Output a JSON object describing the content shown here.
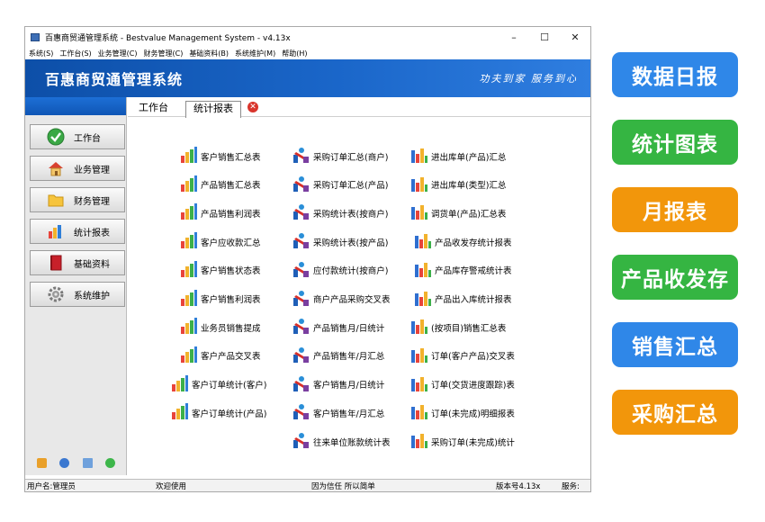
{
  "window": {
    "title": "百惠商贸通管理系统 - Bestvalue Management System - v4.13x",
    "controls": [
      "–",
      "☐",
      "✕"
    ]
  },
  "menu": [
    "系统(S)",
    "工作台(S)",
    "业务管理(C)",
    "财务管理(C)",
    "基础资料(B)",
    "系统维护(M)",
    "帮助(H)"
  ],
  "banner": {
    "title": "百惠商贸通管理系统",
    "slogan": "功夫到家 服务到心"
  },
  "sidebar": {
    "items": [
      {
        "label": "工作台",
        "icon": "check-icon"
      },
      {
        "label": "业务管理",
        "icon": "home-icon"
      },
      {
        "label": "财务管理",
        "icon": "folder-icon"
      },
      {
        "label": "统计报表",
        "icon": "chart-icon"
      },
      {
        "label": "基础资料",
        "icon": "book-icon"
      },
      {
        "label": "系统维护",
        "icon": "gear-icon"
      }
    ],
    "tools": [
      "edit-icon",
      "clock-icon",
      "window-icon",
      "plus-icon"
    ]
  },
  "tabs": [
    {
      "label": "工作台",
      "active": false
    },
    {
      "label": "统计报表",
      "active": true
    }
  ],
  "reports": {
    "col1": [
      "客户销售汇总表",
      "产品销售汇总表",
      "产品销售利润表",
      "客户应收款汇总",
      "客户销售状态表",
      "客户销售利润表",
      "业务员销售提成",
      "客户产品交叉表",
      "客户订单统计(客户)",
      "客户订单统计(产品)"
    ],
    "col2": [
      "采购订单汇总(商户)",
      "采购订单汇总(产品)",
      "采购统计表(按商户)",
      "采购统计表(按产品)",
      "应付款统计(按商户)",
      "商户产品采购交叉表",
      "产品销售月/日统计",
      "产品销售年/月汇总",
      "客户销售月/日统计",
      "客户销售年/月汇总",
      "往来单位账款统计表"
    ],
    "col3": [
      "进出库单(产品)汇总",
      "进出库单(类型)汇总",
      "调货单(产品)汇总表",
      "产品收发存统计报表",
      "产品库存警戒统计表",
      "产品出入库统计报表",
      "(按项目)销售汇总表",
      "订单(客户产品)交叉表",
      "订单(交货进度跟踪)表",
      "订单(未完成)明细报表",
      "采购订单(未完成)统计"
    ]
  },
  "status": {
    "user": "用户名:管理员",
    "welcome": "欢迎使用",
    "motto": "因为信任 所以简单",
    "version": "版本号4.13x",
    "service": "服务:"
  },
  "tags": [
    {
      "label": "数据日报",
      "color": "#2f87e8"
    },
    {
      "label": "统计图表",
      "color": "#35b542"
    },
    {
      "label": "月报表",
      "color": "#f2960b"
    },
    {
      "label": "产品收发存",
      "color": "#35b542"
    },
    {
      "label": "销售汇总",
      "color": "#2f87e8"
    },
    {
      "label": "采购汇总",
      "color": "#f2960b"
    }
  ]
}
